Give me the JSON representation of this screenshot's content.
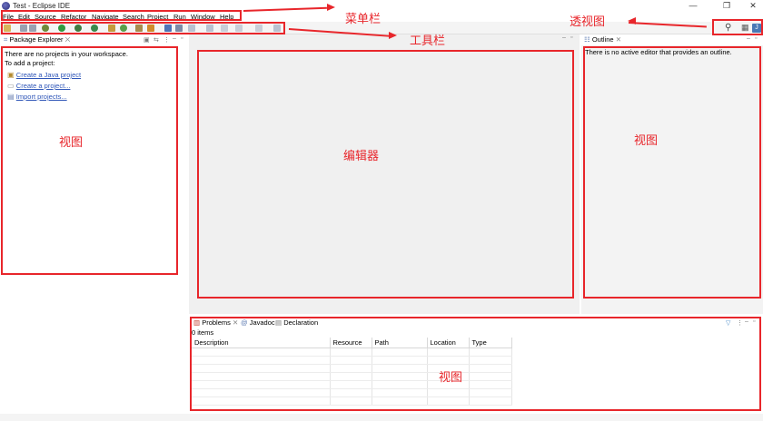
{
  "window": {
    "title": "Test - Eclipse IDE",
    "minimize": "—",
    "maximize": "❐",
    "close": "✕"
  },
  "menu": [
    "File",
    "Edit",
    "Source",
    "Refactor",
    "Navigate",
    "Search",
    "Project",
    "Run",
    "Window",
    "Help"
  ],
  "toolbar": {
    "icons": [
      "new-icon",
      "save-icon",
      "save-all-icon",
      "debug-icon",
      "run-icon",
      "external-tools-icon",
      "coverage-icon",
      "new-java-project-icon",
      "new-package-icon",
      "new-class-icon",
      "open-type-icon",
      "search-icon",
      "toggle-mark-icon",
      "next-annotation-icon",
      "prev-annotation-icon",
      "last-edit-icon",
      "back-icon",
      "forward-icon",
      "pin-editor-icon"
    ]
  },
  "perspective": {
    "search_icon": "⚲",
    "open_perspective_icon": "▦",
    "java_perspective_icon": "J"
  },
  "package_explorer": {
    "tab_label": "Package Explorer",
    "message_line1": "There are no projects in your workspace.",
    "message_line2": "To add a project:",
    "links": [
      "Create a Java project",
      "Create a project...",
      "Import projects..."
    ]
  },
  "outline": {
    "tab_label": "Outline",
    "message": "There is no active editor that provides an outline."
  },
  "bottom_panel": {
    "tabs": [
      "Problems",
      "Javadoc",
      "Declaration"
    ],
    "items_count": "0 items",
    "columns": [
      "Description",
      "Resource",
      "Path",
      "Location",
      "Type"
    ]
  },
  "annotations": {
    "menubar": "菜单栏",
    "toolbar": "工具栏",
    "perspective": "透视图",
    "left_view": "视图",
    "editor": "编辑器",
    "right_view": "视图",
    "bottom_view": "视图"
  },
  "colors": {
    "annotation_red": "#e8262b",
    "link_blue": "#2f56b8",
    "muted_bg": "#f0f0f0"
  }
}
